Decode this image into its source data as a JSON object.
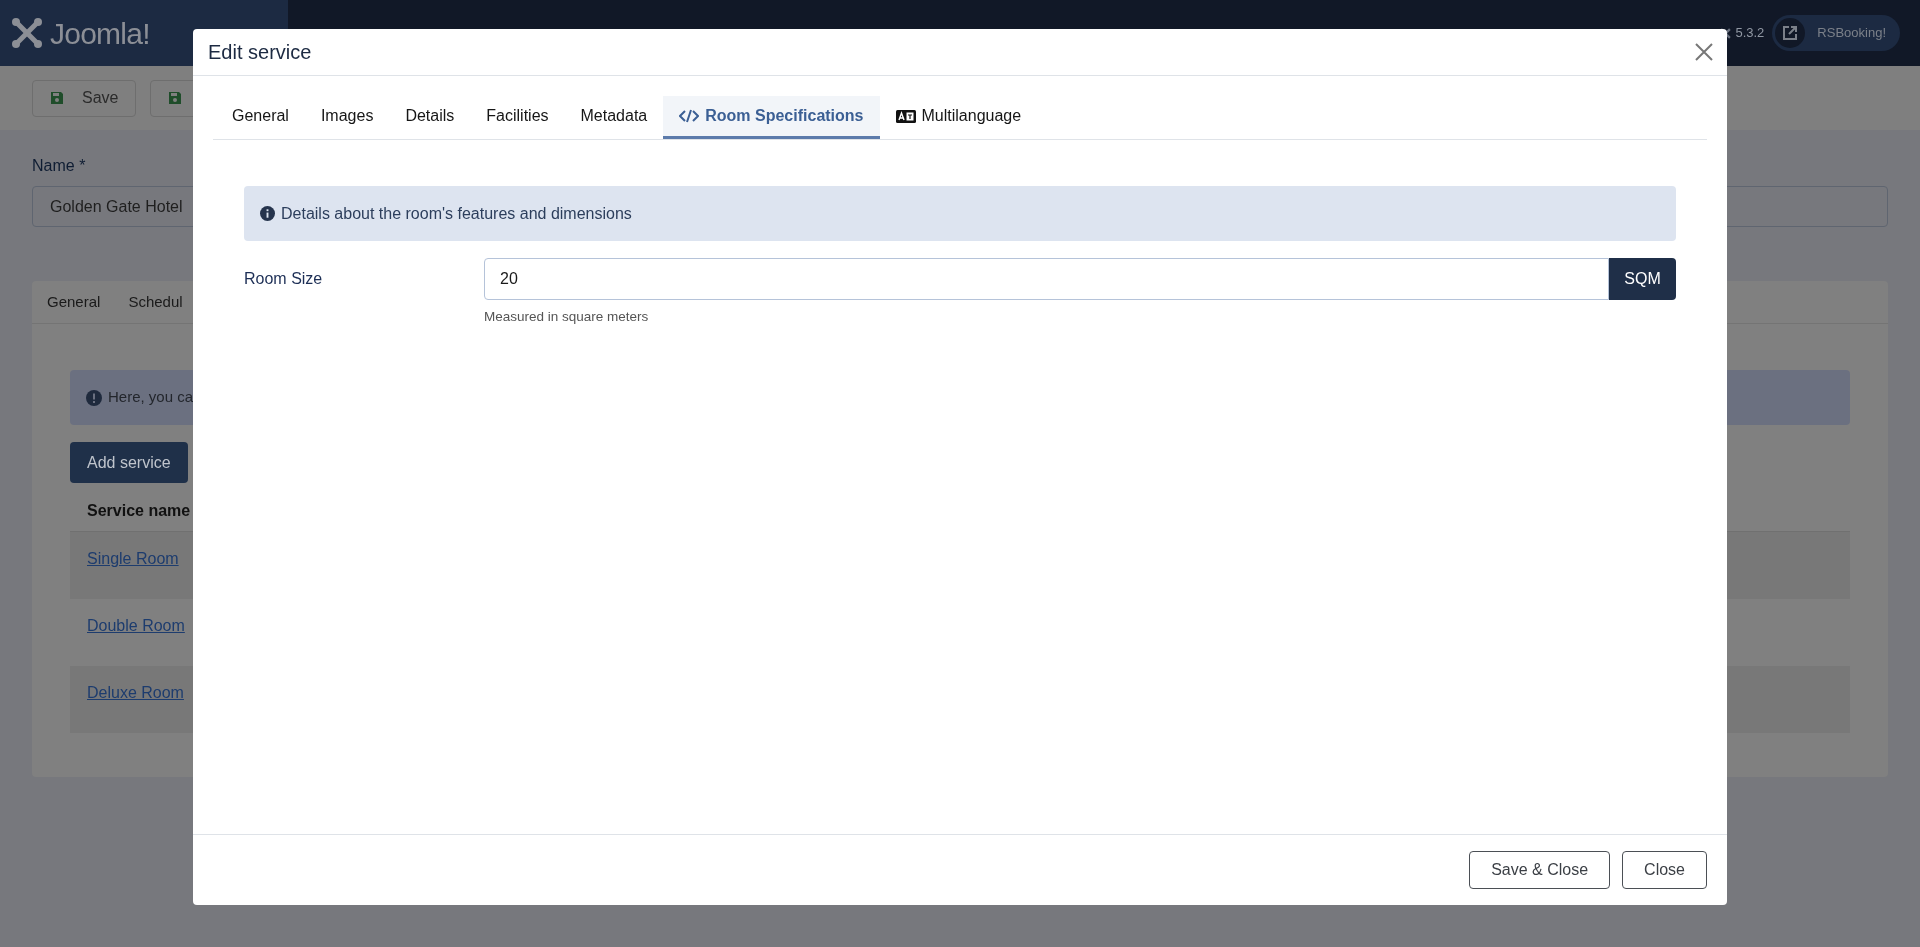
{
  "header": {
    "logo": "Joomla!",
    "version": "5.3.2",
    "site_link": "RSBooking!"
  },
  "toolbar": {
    "save_button": "Save"
  },
  "form": {
    "name_label": "Name *",
    "name_value": "Golden Gate Hotel"
  },
  "card": {
    "tabs": [
      "General",
      "Schedul"
    ],
    "alert": "Here, you ca",
    "add_button": "Add service",
    "table": {
      "columns": [
        "Service name"
      ],
      "rows": [
        {
          "name": "Single Room"
        },
        {
          "name": "Double Room"
        },
        {
          "name": "Deluxe Room"
        }
      ]
    }
  },
  "modal": {
    "title": "Edit service",
    "tabs": [
      {
        "label": "General",
        "kind": "plain",
        "selected": false
      },
      {
        "label": "Images",
        "kind": "plain",
        "selected": false
      },
      {
        "label": "Details",
        "kind": "plain",
        "selected": false
      },
      {
        "label": "Facilities",
        "kind": "plain",
        "selected": false
      },
      {
        "label": "Metadata",
        "kind": "plain",
        "selected": false
      },
      {
        "label": "Room Specifications",
        "kind": "code",
        "selected": true
      },
      {
        "label": "Multilanguage",
        "kind": "language",
        "selected": false
      }
    ],
    "alert": "Details about the room's features and dimensions",
    "field": {
      "label": "Room Size",
      "value": "20",
      "unit": "SQM",
      "help": "Measured in square meters"
    },
    "buttons": [
      "Save & Close",
      "Close"
    ]
  }
}
